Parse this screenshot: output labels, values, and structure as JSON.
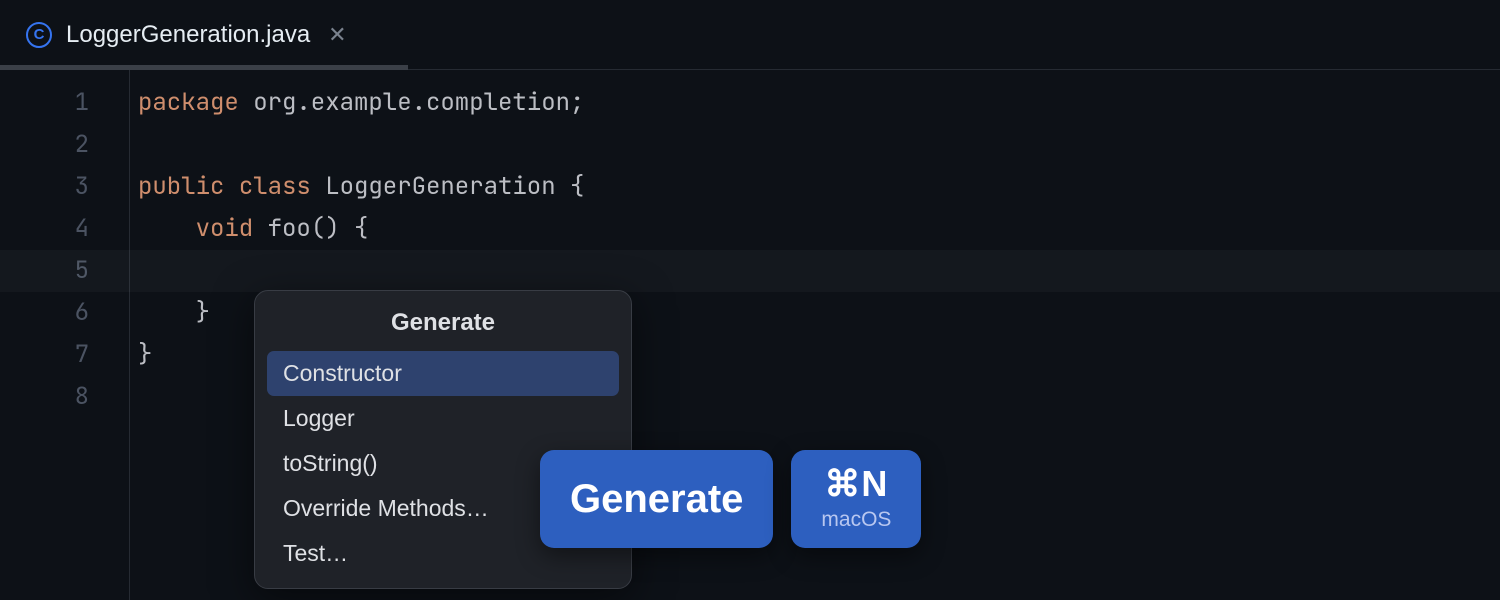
{
  "tab": {
    "icon_letter": "C",
    "filename": "LoggerGeneration.java"
  },
  "gutter": [
    "1",
    "2",
    "3",
    "4",
    "5",
    "6",
    "7",
    "8"
  ],
  "code": {
    "l1": {
      "kw": "package",
      "rest": " org.example.completion;"
    },
    "l2": "",
    "l3": {
      "kw1": "public",
      "kw2": "class",
      "name": " LoggerGeneration ",
      "brace": "{"
    },
    "l4": {
      "indent": "    ",
      "kw": "void",
      "call": " foo() ",
      "brace": "{"
    },
    "l5": "",
    "l6": {
      "indent": "    ",
      "brace": "}"
    },
    "l7": {
      "brace": "}"
    }
  },
  "popup": {
    "title": "Generate",
    "items": [
      "Constructor",
      "Logger",
      "toString()",
      "Override Methods…",
      "Test…"
    ]
  },
  "tooltip": {
    "action": "Generate",
    "shortcut": "⌘N",
    "platform": "macOS"
  }
}
